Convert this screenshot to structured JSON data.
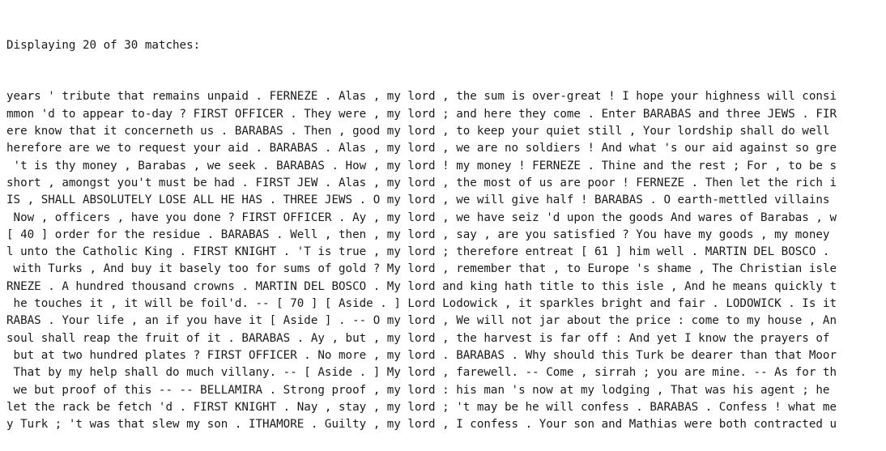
{
  "header": "Displaying 20 of 30 matches:",
  "rows": [
    {
      "left": "years ' tribute that remains unpaid . FERNEZE . Alas , ",
      "key": "my lord",
      "right": " , the sum is over-great ! I hope your highness will consi"
    },
    {
      "left": "mmon 'd to appear to-day ? FIRST OFFICER . They were , ",
      "key": "my lord",
      "right": " ; and here they come . Enter BARABAS and three JEWS . FIR"
    },
    {
      "left": "ere know that it concerneth us . BARABAS . Then , good ",
      "key": "my lord",
      "right": " , to keep your quiet still , Your lordship shall do well"
    },
    {
      "left": "herefore are we to request your aid . BARABAS . Alas , ",
      "key": "my lord",
      "right": " , we are no soldiers ! And what 's our aid against so gre"
    },
    {
      "left": " 't is thy money , Barabas , we seek . BARABAS . How , ",
      "key": "my lord",
      "right": " ! my money ! FERNEZE . Thine and the rest ; For , to be s"
    },
    {
      "left": "short , amongst you't must be had . FIRST JEW . Alas , ",
      "key": "my lord",
      "right": " , the most of us are poor ! FERNEZE . Then let the rich i"
    },
    {
      "left": "IS , SHALL ABSOLUTELY LOSE ALL HE HAS . THREE JEWS . O ",
      "key": "my lord",
      "right": " , we will give half ! BARABAS . O earth-mettled villains"
    },
    {
      "left": " Now , officers , have you done ? FIRST OFFICER . Ay , ",
      "key": "my lord",
      "right": " , we have seiz 'd upon the goods And wares of Barabas , w"
    },
    {
      "left": "[ 40 ] order for the residue . BARABAS . Well , then , ",
      "key": "my lord",
      "right": " , say , are you satisfied ? You have my goods , my money"
    },
    {
      "left": "l unto the Catholic King . FIRST KNIGHT . 'T is true , ",
      "key": "my lord",
      "right": " ; therefore entreat [ 61 ] him well . MARTIN DEL BOSCO ."
    },
    {
      "left": " with Turks , And buy it basely too for sums of gold ? ",
      "key": "My lord",
      "right": " , remember that , to Europe 's shame , The Christian isle"
    },
    {
      "left": "RNEZE . A hundred thousand crowns . MARTIN DEL BOSCO . ",
      "key": "My lord",
      "right": " and king hath title to this isle , And he means quickly t"
    },
    {
      "left": " he touches it , it will be foil'd. -- [ 70 ] [ Aside . ] ",
      "key": "Lord",
      "right": " Lodowick , it sparkles bright and fair . LODOWICK . Is it"
    },
    {
      "left": "RABAS . Your life , an if you have it [ Aside ] . -- O ",
      "key": "my lord",
      "right": " , We will not jar about the price : come to my house , An"
    },
    {
      "left": "soul shall reap the fruit of it . BARABAS . Ay , but , ",
      "key": "my lord",
      "right": " , the harvest is far off : And yet I know the prayers of"
    },
    {
      "left": " but at two hundred plates ? FIRST OFFICER . No more , ",
      "key": "my lord",
      "right": " . BARABAS . Why should this Turk be dearer than that Moor"
    },
    {
      "left": " That by my help shall do much villany. -- [ Aside . ] ",
      "key": "My lord",
      "right": " , farewell. -- Come , sirrah ; you are mine. -- As for th"
    },
    {
      "left": " we but proof of this -- -- BELLAMIRA . Strong proof , ",
      "key": "my lord",
      "right": " : his man 's now at my lodging , That was his agent ; he"
    },
    {
      "left": "let the rack be fetch 'd . FIRST KNIGHT . Nay , stay , ",
      "key": "my lord",
      "right": " ; 't may be he will confess . BARABAS . Confess ! what me"
    },
    {
      "left": "y Turk ; 't was that slew my son . ITHAMORE . Guilty , ",
      "key": "my lord",
      "right": " , I confess . Your son and Mathias were both contracted u"
    }
  ]
}
